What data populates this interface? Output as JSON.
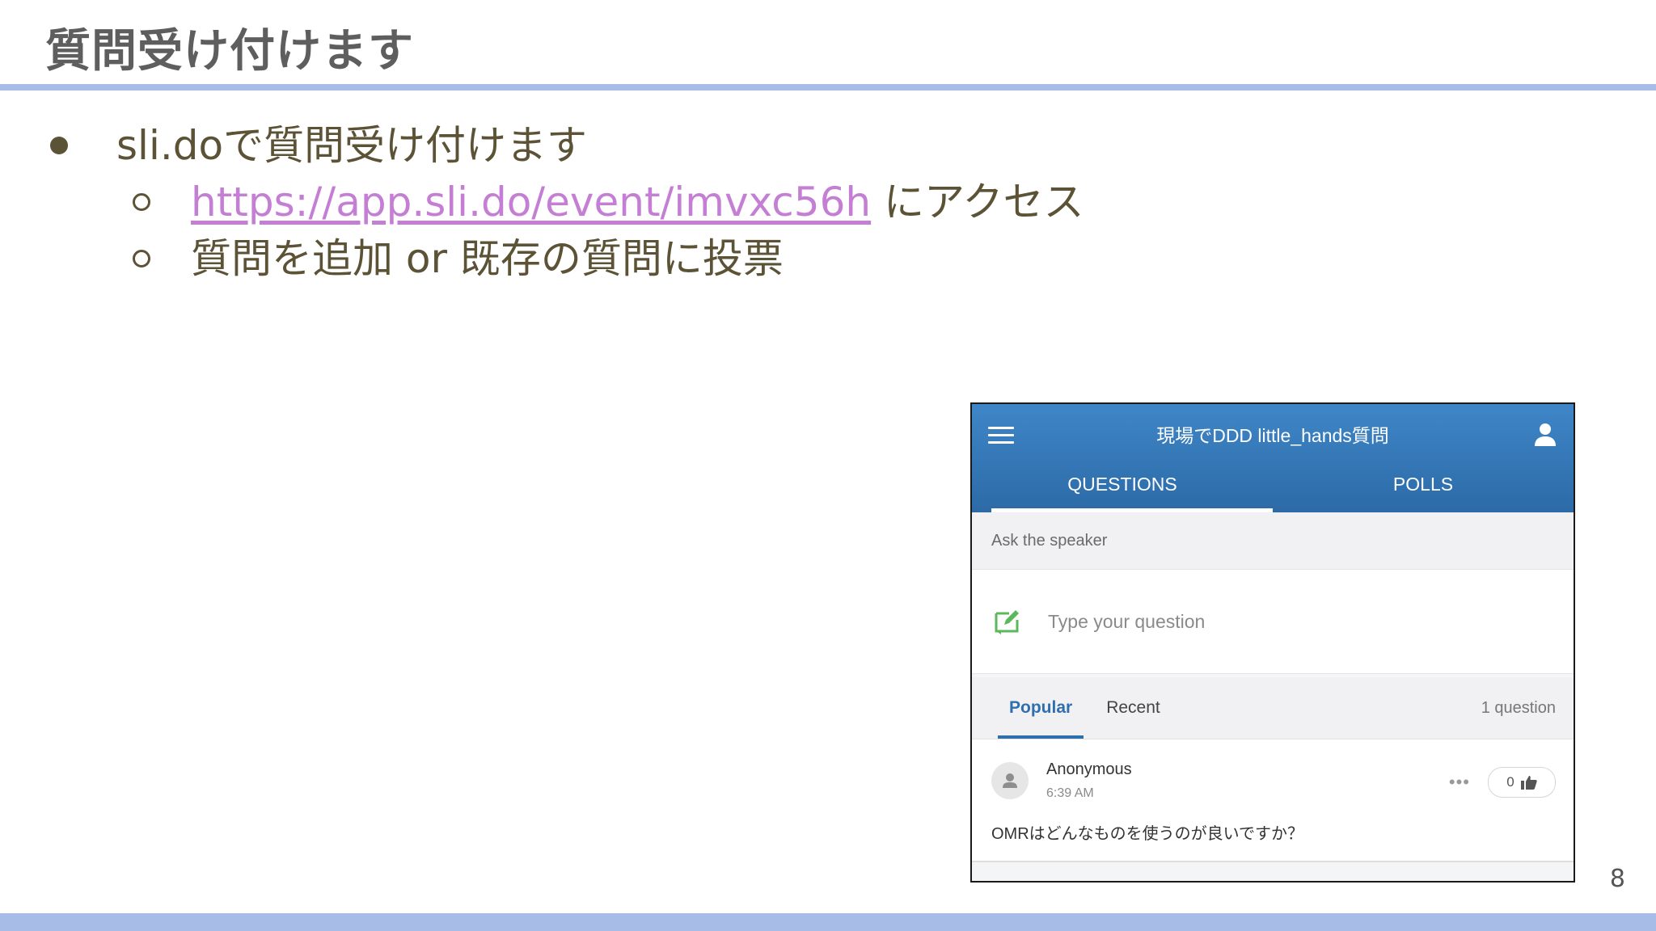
{
  "slide": {
    "title": "質問受け付けます",
    "bullet1": "sli.doで質問受け付けます",
    "bullet2_link": "https://app.sli.do/event/imvxc56h",
    "bullet2_suffix": " にアクセス",
    "bullet3": "質問を追加 or 既存の質問に投票",
    "page_number": "8"
  },
  "app": {
    "event_title": "現場でDDD little_hands質問",
    "tabs": [
      {
        "label": "QUESTIONS",
        "active": true
      },
      {
        "label": "POLLS",
        "active": false
      }
    ],
    "ask_label": "Ask the speaker",
    "input_placeholder": "Type your question",
    "sort": {
      "popular": "Popular",
      "recent": "Recent",
      "count": "1 question"
    },
    "question": {
      "author": "Anonymous",
      "time": "6:39 AM",
      "votes": "0",
      "text": "OMRはどんなものを使うのが良いですか？"
    },
    "colors": {
      "header": "#2c6aa7",
      "accent": "#2f6fae",
      "compose_icon": "#5cb85c"
    },
    "icons": [
      "hamburger-menu-icon",
      "user-icon",
      "compose-icon",
      "avatar-icon",
      "more-icon",
      "thumbs-up-icon"
    ]
  }
}
